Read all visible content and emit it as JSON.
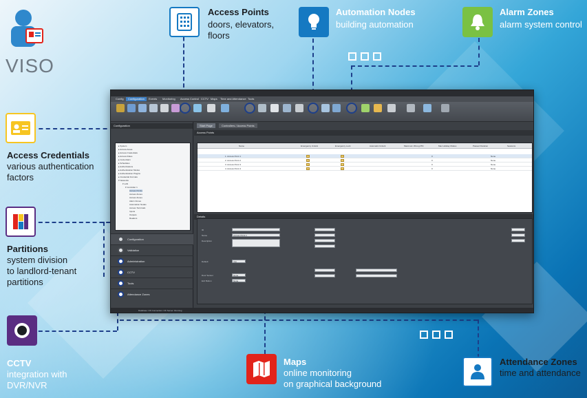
{
  "brand": {
    "name": "VISO"
  },
  "callouts": {
    "access_points": {
      "title": "Access Points",
      "lines": [
        "doors, elevators,",
        "floors"
      ],
      "icon": "door-panel-icon"
    },
    "automation_nodes": {
      "title": "Automation Nodes",
      "lines": [
        "building automation"
      ],
      "icon": "lightbulb-icon"
    },
    "alarm_zones": {
      "title": "Alarm Zones",
      "lines": [
        "alarm system control"
      ],
      "icon": "bell-icon"
    },
    "access_credentials": {
      "title": "Access Credentials",
      "lines": [
        "various authentication",
        "factors"
      ],
      "icon": "id-card-icon"
    },
    "partitions": {
      "title": "Partitions",
      "lines": [
        "system division",
        "to landlord-tenant",
        "partitions"
      ],
      "icon": "partitions-icon"
    },
    "cctv": {
      "title": "CCTV",
      "lines": [
        "integration with",
        "DVR/NVR"
      ],
      "icon": "camera-icon"
    },
    "maps": {
      "title": "Maps",
      "lines": [
        "online monitoring",
        "on graphical background"
      ],
      "icon": "map-icon"
    },
    "attendance_zones": {
      "title": "Attendance Zones",
      "lines": [
        "time and attendance"
      ],
      "icon": "person-icon"
    }
  },
  "colors": {
    "icon_box_blue": "#1579c2",
    "icon_box_green": "#7ac143",
    "icon_box_yellow": "#f7c521",
    "icon_box_red": "#e2241b",
    "icon_box_purple": "#5a2d82",
    "icon_box_white": "#ffffff",
    "dashed_line": "#1d3f8a"
  },
  "app": {
    "menu": [
      "Config",
      "Configuration",
      "Events",
      "Monitoring",
      "Access Control",
      "CCTV",
      "Maps",
      "Time and Attendance",
      "Tools"
    ],
    "tabs": [
      "Start Page",
      "Controllers / Access Points"
    ],
    "left_header": "Configuration",
    "nav": [
      "Configuration",
      "Validation",
      "Administration",
      "CCTV",
      "Tools",
      "Attendance Zones"
    ],
    "grid_header": "Access Points",
    "grid_columns": [
      "Name",
      "Emergency Unlock",
      "Emergency Lock",
      "Automatic Unlock",
      "Maximum Wrong PIN",
      "Max Holiday Modes",
      "Passed Duration",
      "Sessions"
    ],
    "grid_rows": [
      [
        "1. Access Point 1",
        "",
        "",
        "",
        "0",
        "",
        "None",
        ""
      ],
      [
        "2. Access Point 2",
        "",
        "",
        "",
        "0",
        "",
        "None",
        ""
      ],
      [
        "3. Access Point 3",
        "",
        "",
        "",
        "0",
        "",
        "None",
        ""
      ],
      [
        "4. Access Point 4",
        "",
        "",
        "",
        "0",
        "",
        "None",
        ""
      ]
    ],
    "details_header": "Details",
    "details_fields": [
      {
        "label": "ID",
        "value": ""
      },
      {
        "label": "Name",
        "value": "Access Point 1"
      },
      {
        "label": "Description",
        "value": ""
      },
      {
        "label": "Default",
        "value": "Yes"
      },
      {
        "label": "Door Sensor",
        "value": "None"
      },
      {
        "label": "Exit Button",
        "value": "None"
      }
    ],
    "status": "Database: OK   Connection: OK   Server: Running"
  }
}
